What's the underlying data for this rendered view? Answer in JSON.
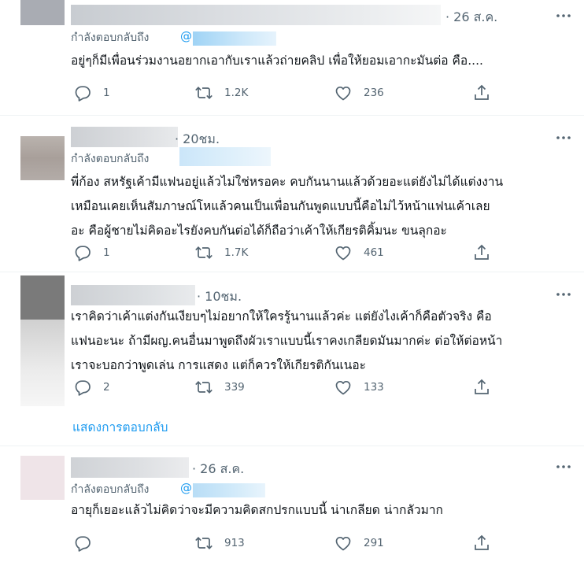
{
  "tweets": [
    {
      "time": "· 26 ส.ค.",
      "reply_prefix": "กำลังตอบกลับถึง",
      "handle_start": "@",
      "lines": [
        "อยู่ๆก็มีเพื่อนร่วมงานอยากเอากับเราแล้วถ่ายคลิป เพื่อให้ยอมเอากะมันต่อ คือ...."
      ],
      "replies": "1",
      "retweets": "1.2K",
      "likes": "236"
    },
    {
      "time": "· 20ชม.",
      "reply_prefix": "กำลังตอบกลับถึง",
      "lines": [
        "พี่ก้อง สหรัฐเค้ามีแฟนอยู่แล้วไม่ใช่หรอคะ คบกันนานแล้วด้วยอะแต่ยังไม่ได้แต่งงาน",
        "เหมือนเคยเห็นสัมภาษณ์โหแล้วคนเป็นเพื่อนกันพูดแบบนี้คือไม่ไว้หน้าแฟนเค้าเลย",
        "อะ คือผู้ชายไม่คิดอะไรยังคบกันต่อได้ก็ถือว่าเค้าให้เกียรติคิ้มนะ ขนลุกอะ"
      ],
      "replies": "1",
      "retweets": "1.7K",
      "likes": "461"
    },
    {
      "time": "· 10ชม.",
      "lines": [
        "เราคิดว่าเค้าแต่งกันเงียบๆไม่อยากให้ใครรู้นานแล้วค่ะ แต่ยังไงเค้าก็คือตัวจริง คือ",
        "แฟนอะนะ ถ้ามีผญ.คนอื่นมาพูดถึงผัวเราแบบนี้เราคงเกลียดมันมากค่ะ ต่อให้ต่อหน้า",
        "เราจะบอกว่าพูดเล่น การแสดง แต่ก็ควรให้เกียรติกันเนอะ"
      ],
      "replies": "2",
      "retweets": "339",
      "likes": "133"
    },
    {
      "time": "· 26 ส.ค.",
      "reply_prefix": "กำลังตอบกลับถึง",
      "handle_start": "@",
      "lines": [
        "อายุก็เยอะแล้วไม่คิดว่าจะมีความคิดสกปรกแบบนี้ น่าเกลียด น่ากลัวมาก"
      ],
      "replies": "",
      "retweets": "913",
      "likes": "291"
    }
  ],
  "show_replies_label": "แสดงการตอบกลับ",
  "colors": {
    "link": "#1d9bf0",
    "muted": "#536471",
    "border": "#eff3f4"
  },
  "icons": [
    "reply-icon",
    "retweet-icon",
    "like-icon",
    "share-icon",
    "more-icon"
  ]
}
